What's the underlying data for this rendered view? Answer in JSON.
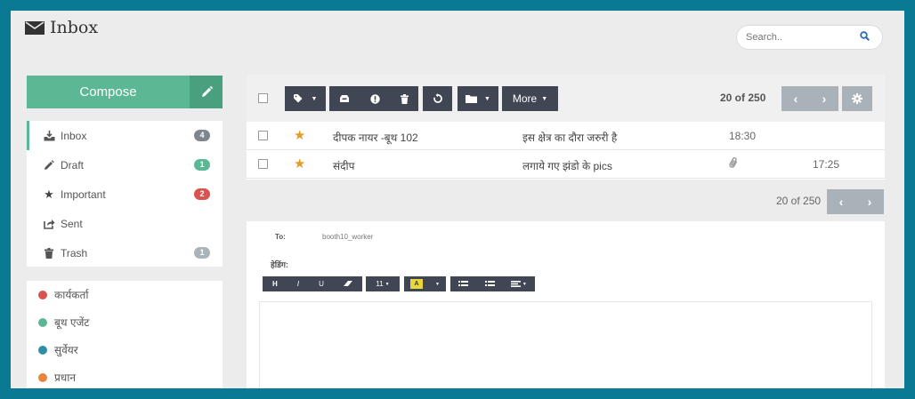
{
  "header": {
    "title": "Inbox"
  },
  "search": {
    "placeholder": "Search.."
  },
  "compose": {
    "label": "Compose"
  },
  "folders": [
    {
      "label": "Inbox",
      "count": "4",
      "badge_color": "#7d8590",
      "icon": "inbox-icon"
    },
    {
      "label": "Draft",
      "count": "1",
      "badge_color": "#5cb795",
      "icon": "pencil-icon"
    },
    {
      "label": "Important",
      "count": "2",
      "badge_color": "#d9534f",
      "icon": "star-icon"
    },
    {
      "label": "Sent",
      "count": "",
      "badge_color": "",
      "icon": "share-icon"
    },
    {
      "label": "Trash",
      "count": "1",
      "badge_color": "#aab4b8",
      "icon": "trash-icon"
    }
  ],
  "labels": [
    {
      "label": "कार्यकर्ता",
      "color": "#d9534f"
    },
    {
      "label": "बूथ एजेंट",
      "color": "#5cb795"
    },
    {
      "label": "सुर्वेयर",
      "color": "#2f8fa8"
    },
    {
      "label": "प्रधान",
      "color": "#e8843c"
    }
  ],
  "toolbar": {
    "more_label": "More",
    "count": "20 of 250"
  },
  "messages": [
    {
      "sender": "दीपक नायर -बूथ 102",
      "subject": "इस क्षेत्र का दौरा जरुरी है",
      "time": "18:30",
      "starred": true,
      "attachment": false
    },
    {
      "sender": "संदीप",
      "subject": "लगाये गए झंडो के pics",
      "time": "17:25",
      "starred": true,
      "attachment": true
    }
  ],
  "pager": {
    "count": "20 of 250"
  },
  "editor": {
    "to_label": "To:",
    "to_value": "booth10_worker",
    "heading_label": "हेडिंग:",
    "font_size": "11",
    "buttons": {
      "bold": "H",
      "italic": "I",
      "underline": "U"
    }
  },
  "colors": {
    "accent": "#5cb795",
    "toolbar": "#404653",
    "frame": "#0a7a94"
  }
}
